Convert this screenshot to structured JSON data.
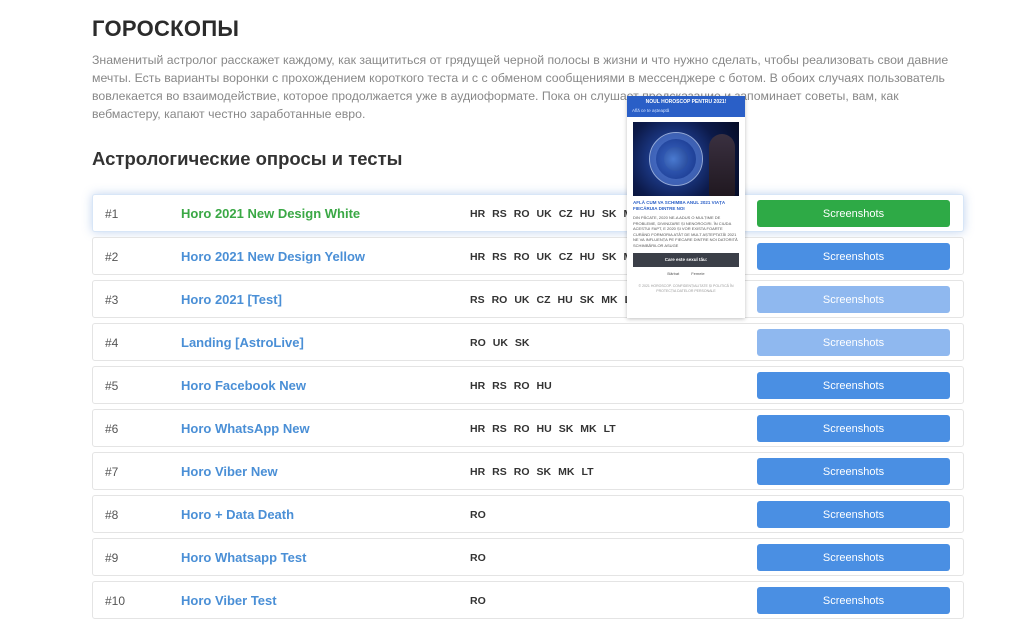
{
  "page": {
    "title": "ГОРОСКОПЫ",
    "intro": "Знаменитый астролог расскажет каждому, как защититься от грядущей черной полосы в жизни и что нужно сделать, чтобы реализовать свои давние мечты. Есть варианты воронки с прохождением короткого теста и с с обменом сообщениями в мессенджере с ботом. В обоих случаях пользователь вовлекается во взаимодействие, которое продолжается уже в аудиоформате. Пока он слушает предсказание и запоминает советы, вам, как вебмастеру, капают честно заработанные евро.",
    "section_title": "Астрологические опросы и тесты"
  },
  "colors": {
    "link": "#4a8fd6",
    "active_link": "#3aa845",
    "button": "#4a8fe3",
    "button_active": "#2eaa46",
    "button_light": "#8fb8ef"
  },
  "rows": [
    {
      "num": "#1",
      "name": "Horo 2021 New Design White",
      "langs": [
        "HR",
        "RS",
        "RO",
        "UK",
        "CZ",
        "HU",
        "SK",
        "MK"
      ],
      "button": "Screenshots",
      "state": "active"
    },
    {
      "num": "#2",
      "name": "Horo 2021 New Design Yellow",
      "langs": [
        "HR",
        "RS",
        "RO",
        "UK",
        "CZ",
        "HU",
        "SK",
        "MK"
      ],
      "button": "Screenshots",
      "state": "normal"
    },
    {
      "num": "#3",
      "name": "Horo 2021 [Test]",
      "langs": [
        "RS",
        "RO",
        "UK",
        "CZ",
        "HU",
        "SK",
        "MK",
        "LT"
      ],
      "button": "Screenshots",
      "state": "light"
    },
    {
      "num": "#4",
      "name": "Landing [AstroLive]",
      "langs": [
        "RO",
        "UK",
        "SK"
      ],
      "button": "Screenshots",
      "state": "light"
    },
    {
      "num": "#5",
      "name": "Horo Facebook New",
      "langs": [
        "HR",
        "RS",
        "RO",
        "HU"
      ],
      "button": "Screenshots",
      "state": "normal"
    },
    {
      "num": "#6",
      "name": "Horo WhatsApp New",
      "langs": [
        "HR",
        "RS",
        "RO",
        "HU",
        "SK",
        "MK",
        "LT"
      ],
      "button": "Screenshots",
      "state": "normal"
    },
    {
      "num": "#7",
      "name": "Horo Viber New",
      "langs": [
        "HR",
        "RS",
        "RO",
        "SK",
        "MK",
        "LT"
      ],
      "button": "Screenshots",
      "state": "normal"
    },
    {
      "num": "#8",
      "name": "Horo + Data Death",
      "langs": [
        "RO"
      ],
      "button": "Screenshots",
      "state": "normal"
    },
    {
      "num": "#9",
      "name": "Horo Whatsapp Test",
      "langs": [
        "RO"
      ],
      "button": "Screenshots",
      "state": "normal"
    },
    {
      "num": "#10",
      "name": "Horo Viber Test",
      "langs": [
        "RO"
      ],
      "button": "Screenshots",
      "state": "normal"
    }
  ],
  "preview": {
    "header_title": "NOUL HOROSCOP PENTRU 2021!",
    "header_sub": "Află ce te așteaptă",
    "lead": "AFLĂ CUM VA SCHIMBA ANUL 2021 VIAȚA FIECĂRUIA DINTRE NOI",
    "body": "DIN PĂCATE, 2020 NE-A ADUS O MULȚIME DE PROBLEME, DIVINIZARE ȘI NENOROCIRI. ÎN CIUDA ACESTUI FAPT, E 2020 ȘI VOR EXISTA FOARTE CURÂND FORMORIA ATÂT DE MULT AȘTEPTATĂ! 2021 NE VA INFLUENȚA PE FIECARE DINTRE NOI DATORITĂ SCHIMBĂRILOR ASUGE",
    "cta": "Care este sexul tău:",
    "option_male": "Bărbat",
    "option_female": "Femeie",
    "footer": "© 2021 HOROSCOP. CONFIDENȚIALITATE ȘI POLITICĂ ÎN PROTECȚIA DATELOR PERSONALE"
  }
}
